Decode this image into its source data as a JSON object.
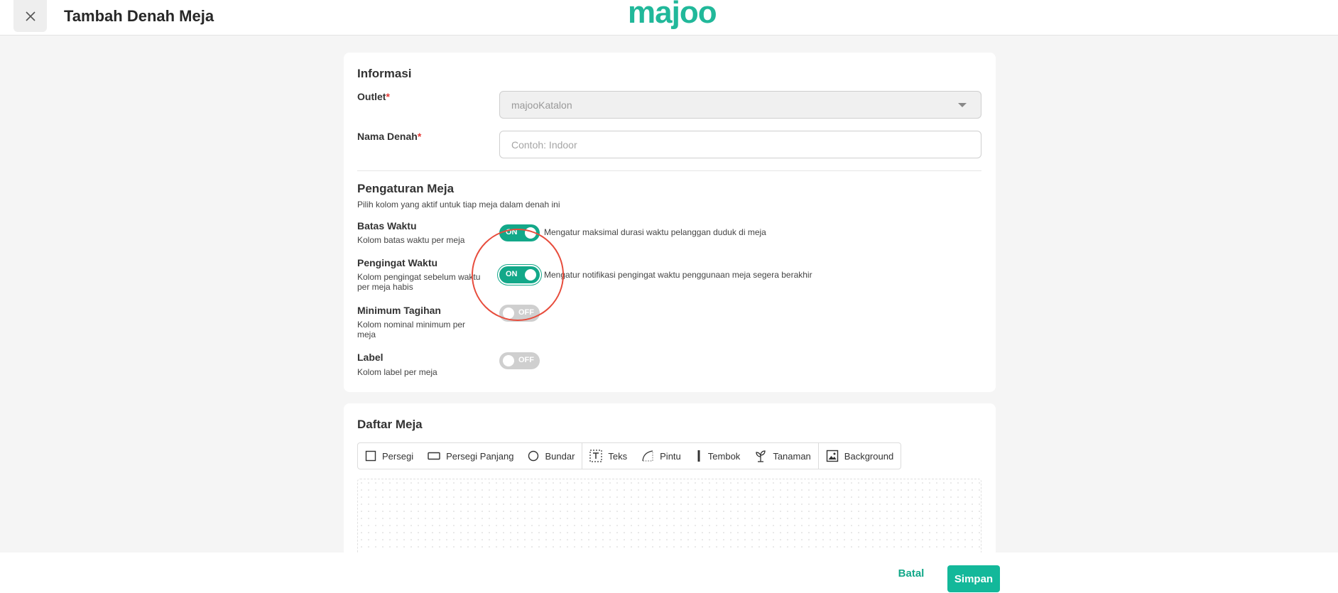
{
  "header": {
    "title": "Tambah Denah Meja",
    "logo_text": "majoo",
    "close_icon": "close-icon"
  },
  "informasi": {
    "title": "Informasi",
    "outlet_label": "Outlet",
    "outlet_value": "majooKatalon",
    "nama_label": "Nama Denah",
    "nama_placeholder": "Contoh: Indoor",
    "nama_value": "",
    "required_mark": "*"
  },
  "pengaturan": {
    "title": "Pengaturan Meja",
    "subtitle": "Pilih kolom yang aktif untuk tiap meja dalam denah ini",
    "options": [
      {
        "title": "Batas Waktu",
        "sub": "Kolom batas waktu per meja",
        "state": "ON",
        "desc": "Mengatur maksimal durasi waktu pelanggan duduk di meja"
      },
      {
        "title": "Pengingat Waktu",
        "sub": "Kolom pengingat sebelum waktu per meja habis",
        "state": "ON",
        "desc": "Mengatur notifikasi pengingat waktu penggunaan meja segera berakhir"
      },
      {
        "title": "Minimum Tagihan",
        "sub": "Kolom nominal minimum per meja",
        "state": "OFF",
        "desc": ""
      },
      {
        "title": "Label",
        "sub": "Kolom label per meja",
        "state": "OFF",
        "desc": ""
      }
    ]
  },
  "daftar": {
    "title": "Daftar Meja",
    "tools": [
      {
        "label": "Persegi",
        "icon": "square-icon"
      },
      {
        "label": "Persegi Panjang",
        "icon": "rectangle-icon"
      },
      {
        "label": "Bundar",
        "icon": "circle-icon"
      },
      {
        "label": "Teks",
        "icon": "text-icon"
      },
      {
        "label": "Pintu",
        "icon": "door-icon"
      },
      {
        "label": "Tembok",
        "icon": "wall-icon"
      },
      {
        "label": "Tanaman",
        "icon": "plant-icon"
      },
      {
        "label": "Background",
        "icon": "image-icon"
      }
    ]
  },
  "footer": {
    "cancel_label": "Batal",
    "save_label": "Simpan"
  },
  "colors": {
    "accent": "#13a889",
    "brand": "#21b89a",
    "highlight": "#e74c3c"
  }
}
